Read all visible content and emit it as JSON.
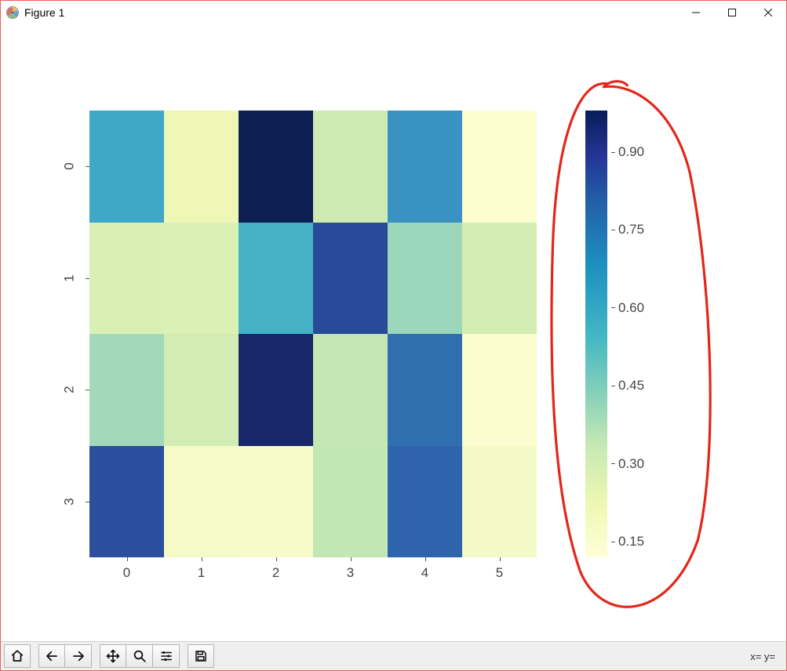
{
  "window": {
    "title": "Figure 1"
  },
  "status": {
    "coord_readout": "x= y="
  },
  "toolbar": {
    "home": "Home",
    "back": "Back",
    "forward": "Forward",
    "pan": "Pan",
    "zoom": "Zoom",
    "configure": "Configure subplots",
    "save": "Save"
  },
  "chart_data": {
    "type": "heatmap",
    "rows": 4,
    "cols": 6,
    "x_ticklabels": [
      "0",
      "1",
      "2",
      "3",
      "4",
      "5"
    ],
    "y_ticklabels": [
      "0",
      "1",
      "2",
      "3"
    ],
    "colormap": "YlGnBu",
    "colorbar": {
      "ticks": [
        0.15,
        0.3,
        0.45,
        0.6,
        0.75,
        0.9
      ],
      "tick_labels": [
        "0.15",
        "0.30",
        "0.45",
        "0.60",
        "0.75",
        "0.90"
      ],
      "vmin_approx": 0.12,
      "vmax_approx": 0.98
    },
    "values": [
      [
        0.68,
        0.22,
        0.97,
        0.33,
        0.72,
        0.15
      ],
      [
        0.28,
        0.27,
        0.62,
        0.88,
        0.44,
        0.3
      ],
      [
        0.42,
        0.3,
        0.94,
        0.38,
        0.8,
        0.15
      ],
      [
        0.86,
        0.18,
        0.18,
        0.38,
        0.82,
        0.16
      ]
    ],
    "cell_colors": [
      [
        "#3fa8c6",
        "#eef7b6",
        "#0e1f56",
        "#cfebb3",
        "#3a92c2",
        "#fcfed2"
      ],
      [
        "#d9efb4",
        "#daf0b4",
        "#44b1c5",
        "#284a98",
        "#9cd6bb",
        "#d4edb3"
      ],
      [
        "#a3d9bb",
        "#d3ecb3",
        "#17276a",
        "#c4e7b4",
        "#2f6fb0",
        "#fbfdd0"
      ],
      [
        "#2b4f9c",
        "#f5fbc7",
        "#f6fbc8",
        "#c3e7b4",
        "#2e64ac",
        "#f4fac5"
      ]
    ],
    "annotation": "red freehand circle around colorbar"
  }
}
